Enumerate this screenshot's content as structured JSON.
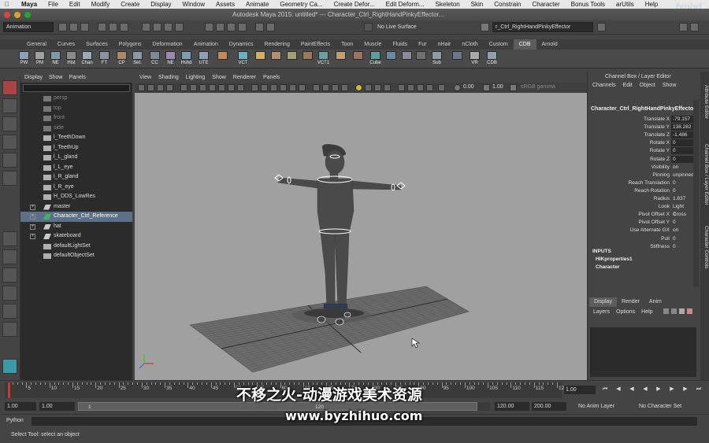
{
  "menubar": {
    "items": [
      "Maya",
      "File",
      "Edit",
      "Modify",
      "Create",
      "Display",
      "Window",
      "Assets",
      "Animate",
      "Geometry Ca...",
      "Create Defor...",
      "Edit Deform...",
      "Skeleton",
      "Skin",
      "Constrain",
      "Character",
      "Bonus Tools",
      "arUtils",
      "Help"
    ],
    "logo": "fxphd"
  },
  "window": {
    "title": "Autodesk Maya 2015: untitled*   ---   Character_Ctrl_RightHandPinkyEffector..."
  },
  "statusline": {
    "mode": "Animation",
    "live_surface": "No Live Surface",
    "name_field": "r_Ctrl_RightHandPinkyEffector"
  },
  "shelf": {
    "tabs": [
      "General",
      "Curves",
      "Surfaces",
      "Polygons",
      "Deformation",
      "Animation",
      "Dynamics",
      "Rendering",
      "PaintEffects",
      "Toon",
      "Muscle",
      "Fluids",
      "Fur",
      "nHair",
      "nCloth",
      "Custom",
      "CDB",
      "Arnold"
    ],
    "active_tab": "CDB",
    "buttons": [
      "PW",
      "PM",
      "NE",
      "Hist",
      "Chan",
      "FT",
      "CP",
      "Set.",
      "CC",
      "NE",
      "Hshd",
      "UTE",
      "",
      "VCT",
      "",
      "",
      "",
      "",
      "VCT1",
      "",
      "",
      "Cube",
      "",
      "",
      "",
      "Sub",
      "",
      "VR",
      "CDB"
    ]
  },
  "outliner": {
    "menu": [
      "Display",
      "Show",
      "Panels"
    ],
    "items": [
      {
        "label": "persp",
        "dim": true,
        "expandable": false
      },
      {
        "label": "top",
        "dim": true,
        "expandable": false
      },
      {
        "label": "front",
        "dim": true,
        "expandable": false
      },
      {
        "label": "side",
        "dim": true,
        "expandable": false
      },
      {
        "label": "l_TeethDown",
        "dim": false,
        "expandable": false
      },
      {
        "label": "l_TeethUp",
        "dim": false,
        "expandable": false
      },
      {
        "label": "l_L_gland",
        "dim": false,
        "expandable": false
      },
      {
        "label": "l_L_eye",
        "dim": false,
        "expandable": false
      },
      {
        "label": "l_R_gland",
        "dim": false,
        "expandable": false
      },
      {
        "label": "l_R_eye",
        "dim": false,
        "expandable": false
      },
      {
        "label": "H_DDS_LowRes",
        "dim": false,
        "expandable": false
      },
      {
        "label": "master",
        "dim": false,
        "expandable": true
      },
      {
        "label": "Character_Ctrl_Reference",
        "dim": false,
        "expandable": true,
        "selected": true
      },
      {
        "label": "hat",
        "dim": false,
        "expandable": true
      },
      {
        "label": "skateboard",
        "dim": false,
        "expandable": true
      },
      {
        "label": "defaultLightSet",
        "dim": false,
        "expandable": false
      },
      {
        "label": "defaultObjectSet",
        "dim": false,
        "expandable": false
      }
    ]
  },
  "viewport": {
    "menu": [
      "View",
      "Shading",
      "Lighting",
      "Show",
      "Renderer",
      "Panels"
    ],
    "exposure": "0.00",
    "gamma": "1.00",
    "color_space": "sRGB gamma"
  },
  "channel_box": {
    "title": "Channel Box / Layer Editor",
    "menu": [
      "Channels",
      "Edit",
      "Object",
      "Show"
    ],
    "object": "Character_Ctrl_RightHandPinkyEffecto...",
    "attrs": [
      {
        "label": "Translate X",
        "value": "-79.157",
        "keyed": true
      },
      {
        "label": "Translate Y",
        "value": "138.282",
        "keyed": true
      },
      {
        "label": "Translate Z",
        "value": "-1.486",
        "keyed": true
      },
      {
        "label": "Rotate X",
        "value": "0",
        "keyed": true
      },
      {
        "label": "Rotate Y",
        "value": "0",
        "keyed": true
      },
      {
        "label": "Rotate Z",
        "value": "0",
        "keyed": true
      },
      {
        "label": "Visibility",
        "value": "on",
        "keyed": false
      },
      {
        "label": "Pinning",
        "value": "unpinned",
        "keyed": false
      },
      {
        "label": "Reach Translation",
        "value": "0",
        "keyed": false
      },
      {
        "label": "Reach Rotation",
        "value": "0",
        "keyed": false
      },
      {
        "label": "Radius",
        "value": "1.837",
        "keyed": false
      },
      {
        "label": "Look",
        "value": "Light Cross",
        "keyed": false
      },
      {
        "label": "Pivot Offset X",
        "value": "0",
        "keyed": false
      },
      {
        "label": "Pivot Offset Y",
        "value": "0",
        "keyed": false
      },
      {
        "label": "Use Alternate GX",
        "value": "on",
        "keyed": false
      },
      {
        "label": "Pull",
        "value": "0",
        "keyed": false
      },
      {
        "label": "Stiffness",
        "value": "0",
        "keyed": false
      }
    ],
    "inputs_header": "INPUTS",
    "inputs": [
      "HIKproperties1",
      "Character"
    ]
  },
  "layers": {
    "tabs": [
      "Display",
      "Render",
      "Anim"
    ],
    "active_tab": "Display",
    "menu": [
      "Layers",
      "Options",
      "Help"
    ]
  },
  "side_tabs": [
    "Attribute Editor",
    "Channel Box / Layer Editor",
    "Character Controls"
  ],
  "timeline": {
    "ticks": [
      "5",
      "10",
      "15",
      "20",
      "25",
      "30",
      "35",
      "40",
      "45",
      "50",
      "55",
      "60",
      "65",
      "70",
      "75",
      "80",
      "85",
      "90",
      "95",
      "100",
      "105",
      "110",
      "115",
      "120"
    ],
    "current_frame": "1.00"
  },
  "range": {
    "start": "1.00",
    "anim_start": "1.00",
    "current": "1",
    "range_label": "120",
    "anim_end": "120.00",
    "end": "200.00",
    "anim_layer": "No Anim Layer",
    "char_set": "No Character Set"
  },
  "command_line": {
    "label": "Python"
  },
  "help_line": {
    "text": "Select Tool: select an object"
  },
  "watermark": {
    "cn": "不移之火-动漫游戏美术资源",
    "url": "www.byzhihuo.com"
  }
}
